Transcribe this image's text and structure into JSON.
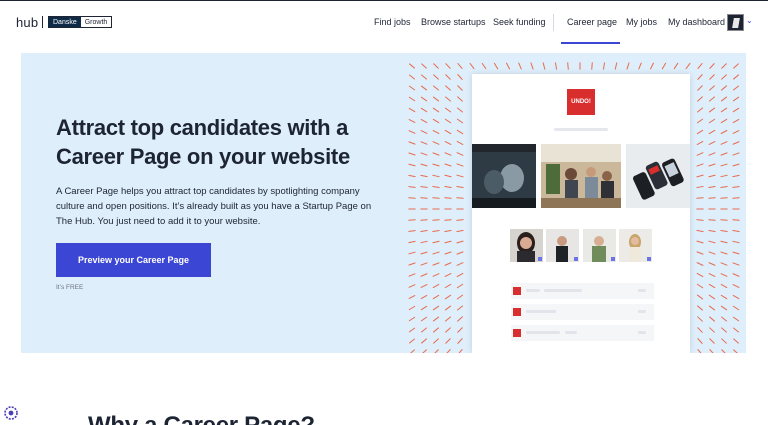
{
  "header": {
    "logo_text": "hub",
    "partner_logo": {
      "name": "Danske",
      "suffix": "Growth"
    },
    "nav": [
      {
        "label": "Find jobs"
      },
      {
        "label": "Browse startups"
      },
      {
        "label": "Seek funding"
      },
      {
        "label": "Career page",
        "active": true
      },
      {
        "label": "My jobs"
      },
      {
        "label": "My dashboard"
      }
    ],
    "avatar_icon": "user-avatar",
    "chevron_icon": "chevron-down-icon"
  },
  "hero": {
    "title": "Attract top candidates with a Career Page on your website",
    "description": "A Career Page helps you attract top candidates by spotlighting company culture and open positions. It’s already built as you have a Startup Page on The Hub. You just need to add it to your website.",
    "cta_label": "Preview your Career Page",
    "note": "It’s FREE"
  },
  "mockup": {
    "company_logo_text": "UNDO!"
  },
  "section": {
    "title": "Why a Career Page?"
  },
  "colors": {
    "accent": "#3b46d4",
    "hero_bg": "#deeefa",
    "brand_red": "#d92e2e",
    "text": "#1d2433"
  }
}
